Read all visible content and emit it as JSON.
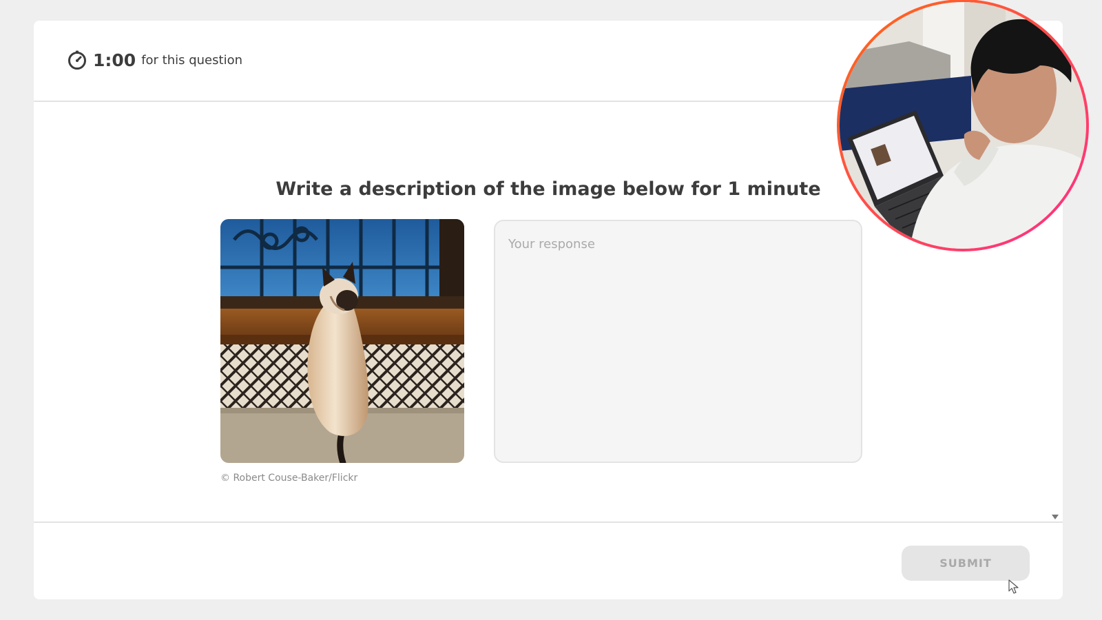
{
  "header": {
    "timer_icon": "stopwatch-icon",
    "timer_value": "1:00",
    "timer_label": "for this question"
  },
  "question": {
    "prompt": "Write a description of the image below for 1 minute",
    "image_subject": "siamese-cat-at-window",
    "image_credit": "© Robert Couse-Baker/Flickr"
  },
  "response": {
    "value": "",
    "placeholder": "Your response"
  },
  "footer": {
    "submit_label": "SUBMIT"
  },
  "overlay": {
    "webcam_ring_colors": [
      "#ff6a13",
      "#ff2d8a"
    ]
  },
  "colors": {
    "background": "#efefef",
    "card": "#ffffff",
    "text": "#3c3c3c",
    "submit_disabled_bg": "#e5e5e5",
    "submit_disabled_text": "#a9a9a9"
  }
}
